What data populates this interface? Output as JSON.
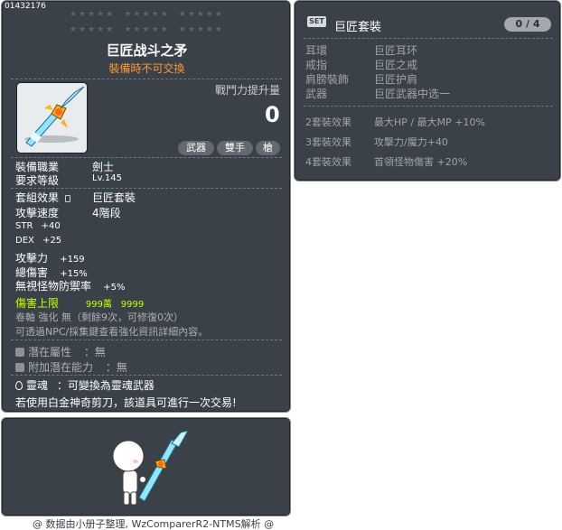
{
  "item": {
    "id": "01432176",
    "name": "巨匠战斗之矛",
    "trade_note": "裝備時不可交換",
    "combat_power_label": "戰鬥力提升量",
    "combat_power_value": "0",
    "tags": [
      "武器",
      "雙手",
      "槍"
    ],
    "stars": "★★★★★  ★★★★★  ★★★★★",
    "requirements": {
      "job_label": "裝備職業",
      "job_value": "劍士",
      "level_label": "要求等級",
      "level_value": "Lv.145"
    },
    "set_effect": {
      "label": "套組效果",
      "value": "巨匠套裝"
    },
    "attack_speed": {
      "label": "攻擊速度",
      "value": "4階段"
    },
    "stats": [
      {
        "label": "STR",
        "value": "+40"
      },
      {
        "label": "DEX",
        "value": "+25"
      },
      {
        "label": "攻擊力",
        "value": "+159"
      },
      {
        "label": "總傷害",
        "value": "+15%"
      },
      {
        "label": "無視怪物防禦率",
        "value": "+5%"
      }
    ],
    "damage_cap": {
      "label": "傷害上限",
      "value1": "999萬",
      "value2": "9999"
    },
    "upgrade_note": "卷軸 強化 無（剩餘9次，可修復0次）",
    "npc_note": "可透過NPC/採集鍵查看強化資訊詳細內容。",
    "potential": {
      "label": "潛在屬性",
      "value": "：無"
    },
    "additional_potential": {
      "label": "附加潛在能力",
      "value": "：無"
    },
    "soul": {
      "label": "靈魂",
      "value": "：可變換為靈魂武器"
    },
    "scissors_note": "若使用白金神奇剪刀，該道具可進行一次交易!"
  },
  "set": {
    "badge": "SET",
    "name": "巨匠套裝",
    "count": "0 / 4",
    "pieces": [
      {
        "slot": "耳環",
        "item": "巨匠耳环"
      },
      {
        "slot": "戒指",
        "item": "巨匠之戒"
      },
      {
        "slot": "肩膀裝飾",
        "item": "巨匠护肩"
      },
      {
        "slot": "武器",
        "item": "巨匠武器中选一"
      }
    ],
    "bonuses": [
      {
        "tier": "2套裝效果",
        "effect": "最大HP / 最大MP  +10%"
      },
      {
        "tier": "3套裝效果",
        "effect": "攻擊力/魔力+40"
      },
      {
        "tier": "4套裝效果",
        "effect": "首領怪物傷害  +20%"
      }
    ]
  },
  "footer": {
    "credit": "@ 数据由小册子整理, WzComparerR2-NTMS解析 @"
  }
}
